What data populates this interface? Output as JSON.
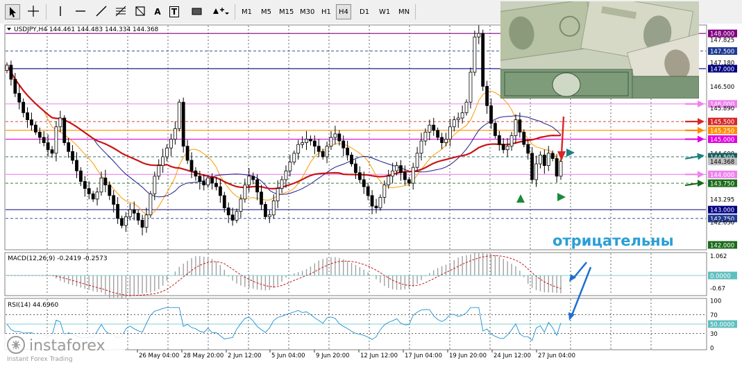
{
  "toolbar": {
    "tools": [
      "cursor-icon",
      "crosshair-icon",
      "vertical-line-icon",
      "horizontal-line-icon",
      "trendline-icon",
      "fibonacci-icon",
      "shapes-icon",
      "text-icon",
      "text-label-icon",
      "rectangle-icon",
      "arrows-icon"
    ],
    "text_tool": "A",
    "label_tool": "T",
    "timeframes": [
      "M1",
      "M5",
      "M15",
      "M30",
      "H1",
      "H4",
      "D1",
      "W1",
      "MN"
    ],
    "active_timeframe": "H4"
  },
  "header": {
    "symbol_info": "USDJPY,H4  144.461 144.483 144.334 144.368"
  },
  "chart_data": [
    {
      "type": "candlestick",
      "symbol": "USDJPY",
      "timeframe": "H4",
      "ohlc": {
        "open": 144.461,
        "high": 144.483,
        "low": 144.334,
        "close": 144.368
      },
      "ylim": [
        141.9,
        148.2
      ],
      "price_labels": [
        {
          "value": 148.0,
          "text": "148.000",
          "style": "tag",
          "bg": "#800080"
        },
        {
          "value": 147.825,
          "text": "147.825",
          "style": "plain"
        },
        {
          "value": 147.5,
          "text": "147.500",
          "style": "tag",
          "bg": "#1f3a93"
        },
        {
          "value": 147.18,
          "text": "147.180",
          "style": "plain"
        },
        {
          "value": 147.0,
          "text": "147.000",
          "style": "tag",
          "bg": "#000080"
        },
        {
          "value": 146.5,
          "text": "146.500",
          "style": "plain"
        },
        {
          "value": 146.0,
          "text": "146.000",
          "style": "tag",
          "bg": "#ee82ee"
        },
        {
          "value": 145.89,
          "text": "145.890",
          "style": "plain"
        },
        {
          "value": 145.5,
          "text": "145.500",
          "style": "tag",
          "bg": "#d62828"
        },
        {
          "value": 145.25,
          "text": "145.250",
          "style": "tag",
          "bg": "#ff8c00"
        },
        {
          "value": 145.0,
          "text": "145.000",
          "style": "tag",
          "bg": "#e000e0"
        },
        {
          "value": 144.6,
          "text": "144.600",
          "style": "plain"
        },
        {
          "value": 144.5,
          "text": "144.500",
          "style": "tag",
          "bg": "#1a5f5f"
        },
        {
          "value": 144.368,
          "text": "144.368",
          "style": "tag",
          "bg": "#c0c0c0",
          "color": "#000000"
        },
        {
          "value": 144.0,
          "text": "144.000",
          "style": "tag",
          "bg": "#ee82ee"
        },
        {
          "value": 143.75,
          "text": "143.750",
          "style": "tag",
          "bg": "#1a6b1a"
        },
        {
          "value": 143.295,
          "text": "143.295",
          "style": "plain"
        },
        {
          "value": 143.0,
          "text": "143.000",
          "style": "tag",
          "bg": "#000080"
        },
        {
          "value": 142.75,
          "text": "142.750",
          "style": "tag",
          "bg": "#1f3a93"
        },
        {
          "value": 142.65,
          "text": "142.650",
          "style": "plain"
        },
        {
          "value": 142.0,
          "text": "142.000",
          "style": "tag",
          "bg": "#1a6b1a"
        }
      ],
      "levels": [
        {
          "value": 148.0,
          "color": "#800080",
          "dash": false
        },
        {
          "value": 147.5,
          "color": "#1f3a93",
          "dash": true
        },
        {
          "value": 147.0,
          "color": "#000080",
          "dash": false
        },
        {
          "value": 146.0,
          "color": "#ee82ee",
          "dash": false
        },
        {
          "value": 145.5,
          "color": "#d62828",
          "dash": true
        },
        {
          "value": 145.25,
          "color": "#ff8c00",
          "dash": false
        },
        {
          "value": 145.0,
          "color": "#e000e0",
          "dash": false
        },
        {
          "value": 144.5,
          "color": "#1a5f5f",
          "dash": true
        },
        {
          "value": 144.0,
          "color": "#ee82ee",
          "dash": false
        },
        {
          "value": 143.75,
          "color": "#1a6b1a",
          "dash": true
        },
        {
          "value": 143.0,
          "color": "#000080",
          "dash": false
        },
        {
          "value": 142.75,
          "color": "#1f3a93",
          "dash": true
        }
      ],
      "closes": [
        147.1,
        146.7,
        146.3,
        146.05,
        145.75,
        145.55,
        145.4,
        145.2,
        145.05,
        144.9,
        144.7,
        144.6,
        145.35,
        145.6,
        144.9,
        144.65,
        144.4,
        144.1,
        143.8,
        143.6,
        143.45,
        143.3,
        143.5,
        143.9,
        143.7,
        143.4,
        143.15,
        142.75,
        142.55,
        142.8,
        143.0,
        142.9,
        142.7,
        142.5,
        142.85,
        143.45,
        143.95,
        144.25,
        144.5,
        144.75,
        145.0,
        145.3,
        146.05,
        144.8,
        144.4,
        144.1,
        143.95,
        143.8,
        143.7,
        143.9,
        143.75,
        143.65,
        143.4,
        143.05,
        142.85,
        142.7,
        142.95,
        143.3,
        143.7,
        143.95,
        143.85,
        143.5,
        143.15,
        142.8,
        142.85,
        143.25,
        143.6,
        143.85,
        144.1,
        144.35,
        144.6,
        144.85,
        144.9,
        145.0,
        144.95,
        144.8,
        144.65,
        144.5,
        144.8,
        145.05,
        145.15,
        144.95,
        144.75,
        144.55,
        144.3,
        144.05,
        143.85,
        143.65,
        143.4,
        143.1,
        143.05,
        143.35,
        143.7,
        143.95,
        144.1,
        144.25,
        144.05,
        143.85,
        143.75,
        144.2,
        144.6,
        144.95,
        145.2,
        145.4,
        145.25,
        145.05,
        144.9,
        145.0,
        145.35,
        145.55,
        145.6,
        145.75,
        146.05,
        146.9,
        147.9,
        148.0,
        146.5,
        145.95,
        145.45,
        145.1,
        144.85,
        144.7,
        144.8,
        145.1,
        145.55,
        145.2,
        144.85,
        144.6,
        143.85,
        144.3,
        144.55,
        144.25,
        144.6,
        144.45,
        143.95,
        144.368
      ]
    },
    {
      "type": "histogram",
      "indicator": "MACD(12,26,9)",
      "label": "MACD(12,26,9) -0.2419 -0.2573",
      "ticks": [
        "1.062",
        "0.0000",
        "-0.67"
      ],
      "ylim": [
        -1.0,
        1.15
      ]
    },
    {
      "type": "line",
      "indicator": "RSI(14)",
      "label": "RSI(14) 44.6960",
      "ticks": [
        "100",
        "70",
        "50.0000",
        "30",
        "0"
      ],
      "ylim": [
        0,
        100
      ]
    }
  ],
  "time_axis": [
    "26 May 04:00",
    "28 May 20:00",
    "2 Jun 12:00",
    "5 Jun 04:00",
    "9 Jun 20:00",
    "12 Jun 12:00",
    "17 Jun 04:00",
    "19 Jun 20:00",
    "24 Jun 12:00",
    "27 Jun 04:00"
  ],
  "annotation_text": "отрицательны",
  "watermark": {
    "brand": "instaforex",
    "tagline": "Instant Forex Trading"
  },
  "colors": {
    "ma_red": "#c81414",
    "ma_orange": "#ff9900",
    "ma_blue": "#1c1c8c",
    "signal_green": "#1a8a3a",
    "arrow_blue": "#1e6fd0",
    "annotation": "#2a9fd6"
  }
}
